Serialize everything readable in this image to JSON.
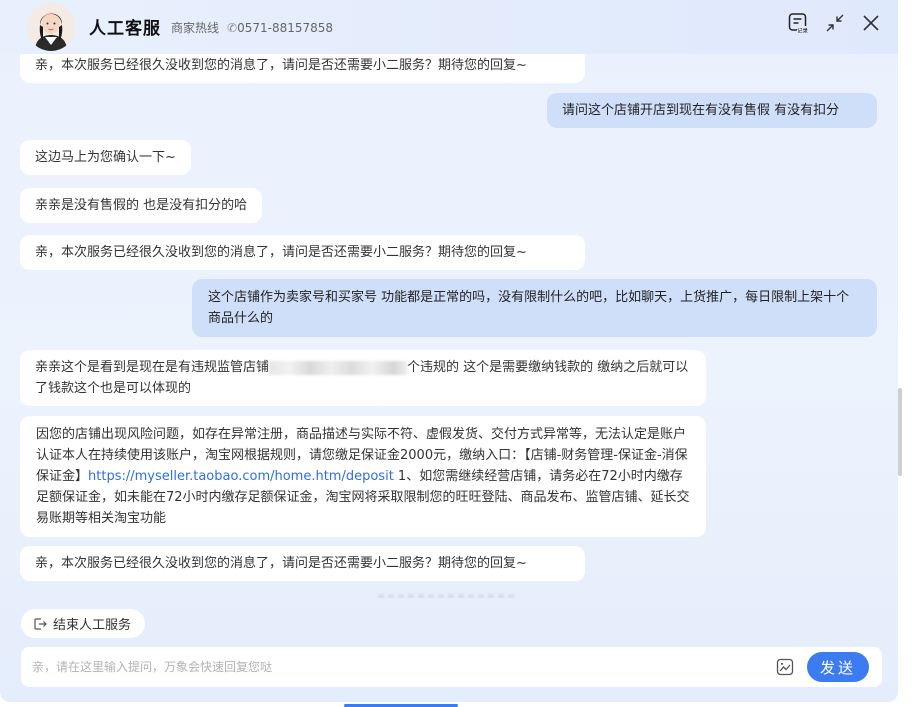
{
  "header": {
    "title": "人工客服",
    "hotline_label": "商家热线",
    "hotline_number": "0571-88157858",
    "icons": [
      "chat-record-icon",
      "minimize-icon",
      "close-icon"
    ],
    "record_icon_label": "记录"
  },
  "messages": [
    {
      "from": "agent",
      "text": "亲，本次服务已经很久没收到您的消息了，请问是否还需要小二服务？期待您的回复~"
    },
    {
      "from": "user",
      "text": "请问这个店铺开店到现在有没有售假 有没有扣分"
    },
    {
      "from": "agent",
      "text": "这边马上为您确认一下~"
    },
    {
      "from": "agent",
      "text": "亲亲是没有售假的 也是没有扣分的哈"
    },
    {
      "from": "agent",
      "text": "亲，本次服务已经很久没收到您的消息了，请问是否还需要小二服务？期待您的回复~"
    },
    {
      "from": "user",
      "text": "这个店铺作为卖家号和买家号 功能都是正常的吗，没有限制什么的吧，比如聊天，上货推广，每日限制上架十个商品什么的"
    },
    {
      "from": "agent",
      "text_before": "亲亲这个是看到是现在是有违规监管店铺",
      "text_after": "个违规的 这个是需要缴纳钱款的 缴纳之后就可以了钱款这个也是可以体现的"
    },
    {
      "from": "agent",
      "text_before": "因您的店铺出现风险问题，如存在异常注册，商品描述与实际不符、虚假发货、交付方式异常等，无法认定是账户认证本人在持续使用该账户，淘宝网根据规则，请您缴足保证金2000元，缴纳入口：【店铺-财务管理-保证金-消保保证金】",
      "link": "https://myseller.taobao.com/home.htm/deposit",
      "text_after": " 1、如您需继续经营店铺，请务必在72小时内缴存足额保证金，如未能在72小时内缴存足额保证金，淘宝网将采取限制您的旺旺登陆、商品发布、监管店铺、延长交易账期等相关淘宝功能"
    },
    {
      "from": "agent",
      "text": "亲，本次服务已经很久没收到您的消息了，请问是否还需要小二服务？期待您的回复~"
    }
  ],
  "end_service_label": "结束人工服务",
  "input": {
    "placeholder": "亲，请在这里输入提问，万象会快速回复您哒",
    "value": ""
  },
  "send_label": "发送",
  "colors": {
    "accent": "#3d7bf0",
    "user_bubble": "#cfdff9",
    "agent_bubble": "#ffffff",
    "link": "#2f6fe0"
  }
}
